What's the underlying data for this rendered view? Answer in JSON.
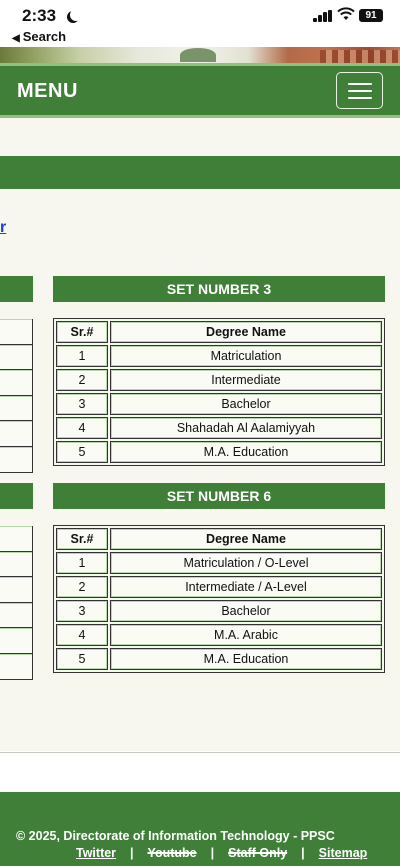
{
  "status_bar": {
    "time": "2:33",
    "back_label": "Search",
    "battery": "91"
  },
  "nav": {
    "title": "MENU"
  },
  "content": {
    "partial_link": "r",
    "sets": [
      {
        "title": "SET NUMBER 3",
        "header": {
          "sr": "Sr.#",
          "degree": "Degree Name"
        },
        "rows": [
          {
            "sr": "1",
            "degree": "Matriculation"
          },
          {
            "sr": "2",
            "degree": "Intermediate"
          },
          {
            "sr": "3",
            "degree": "Bachelor"
          },
          {
            "sr": "4",
            "degree": "Shahadah Al Aalamiyyah"
          },
          {
            "sr": "5",
            "degree": "M.A. Education"
          }
        ]
      },
      {
        "title": "SET NUMBER 6",
        "header": {
          "sr": "Sr.#",
          "degree": "Degree Name"
        },
        "rows": [
          {
            "sr": "1",
            "degree": "Matriculation / O-Level"
          },
          {
            "sr": "2",
            "degree": "Intermediate / A-Level"
          },
          {
            "sr": "3",
            "degree": "Bachelor"
          },
          {
            "sr": "4",
            "degree": "M.A. Arabic"
          },
          {
            "sr": "5",
            "degree": "M.A. Education"
          }
        ]
      }
    ]
  },
  "footer": {
    "copyright": "© 2025, Directorate of Information Technology - PPSC",
    "links": [
      "Twitter",
      "Youtube",
      "Staff Only",
      "Sitemap"
    ],
    "separator": "|"
  },
  "colors": {
    "primary_green": "#3f7f38",
    "light_green": "#8fc07f",
    "page_bg": "#f7f7ef",
    "link_blue": "#1a3ddf"
  }
}
